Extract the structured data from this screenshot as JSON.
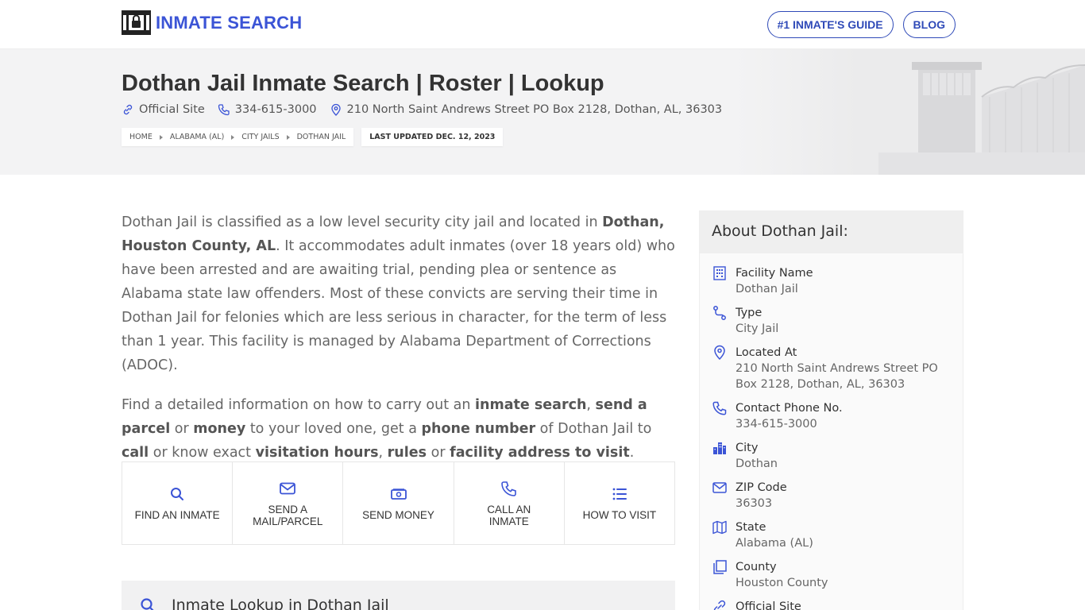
{
  "header": {
    "logo_text": "INMATE SEARCH",
    "nav": [
      "#1 INMATE'S GUIDE",
      "BLOG"
    ]
  },
  "hero": {
    "title": "Dothan Jail Inmate Search | Roster | Lookup",
    "official_site": "Official Site",
    "phone": "334-615-3000",
    "address": "210 North Saint Andrews Street PO Box 2128, Dothan, AL, 36303",
    "breadcrumbs": [
      "HOME",
      "ALABAMA (AL)",
      "CITY JAILS",
      "DOTHAN JAIL"
    ],
    "last_updated": "LAST UPDATED DEC. 12, 2023"
  },
  "intro": {
    "p1": [
      {
        "t": "Dothan Jail is classified as a low level security city jail and located in ",
        "b": false
      },
      {
        "t": "Dothan, Houston County, AL",
        "b": true
      },
      {
        "t": ". It accommodates adult inmates (over 18 years old) who have been arrested and are awaiting trial, pending plea or sentence as Alabama state law offenders. Most of these convicts are serving their time in Dothan Jail for felonies which are less serious in character, for the term of less than 1 year. This facility is managed by Alabama Department of Corrections (ADOC).",
        "b": false
      }
    ],
    "p2": [
      {
        "t": "Find a detailed information on how to carry out an ",
        "b": false
      },
      {
        "t": "inmate search",
        "b": true
      },
      {
        "t": ", ",
        "b": false
      },
      {
        "t": "send a parcel",
        "b": true
      },
      {
        "t": " or ",
        "b": false
      },
      {
        "t": "money",
        "b": true
      },
      {
        "t": " to your loved one, get a ",
        "b": false
      },
      {
        "t": "phone number",
        "b": true
      },
      {
        "t": " of Dothan Jail to ",
        "b": false
      },
      {
        "t": "call",
        "b": true
      },
      {
        "t": " or know exact ",
        "b": false
      },
      {
        "t": "visitation hours",
        "b": true
      },
      {
        "t": ", ",
        "b": false
      },
      {
        "t": "rules",
        "b": true
      },
      {
        "t": " or ",
        "b": false
      },
      {
        "t": "facility address to visit",
        "b": true
      },
      {
        "t": ".",
        "b": false
      }
    ]
  },
  "tiles": [
    {
      "label_1": "FIND AN INMATE",
      "label_2": "",
      "icon": "search-icon"
    },
    {
      "label_1": "SEND A",
      "label_2": "MAIL/PARCEL",
      "icon": "mail-icon"
    },
    {
      "label_1": "SEND MONEY",
      "label_2": "",
      "icon": "money-icon"
    },
    {
      "label_1": "CALL AN",
      "label_2": "INMATE",
      "icon": "phone-icon"
    },
    {
      "label_1": "HOW TO VISIT",
      "label_2": "",
      "icon": "list-icon"
    }
  ],
  "lookup_title": "Inmate Lookup in Dothan Jail",
  "about": {
    "title": "About Dothan Jail:",
    "facts": [
      {
        "label": "Facility Name",
        "value": "Dothan Jail",
        "icon": "building-icon"
      },
      {
        "label": "Type",
        "value": "City Jail",
        "icon": "route-icon"
      },
      {
        "label": "Located At",
        "value": "210 North Saint Andrews Street PO Box 2128, Dothan, AL, 36303",
        "icon": "map-pin-icon"
      },
      {
        "label": "Contact Phone No.",
        "value": "334-615-3000",
        "icon": "phone-icon"
      },
      {
        "label": "City",
        "value": "Dothan",
        "icon": "city-icon"
      },
      {
        "label": "ZIP Code",
        "value": "36303",
        "icon": "mail-icon"
      },
      {
        "label": "State",
        "value": "Alabama (AL)",
        "icon": "map-icon"
      },
      {
        "label": "County",
        "value": "Houston County",
        "icon": "copy-icon"
      },
      {
        "label": "Official Site",
        "value": "",
        "icon": "link-icon"
      }
    ]
  },
  "colors": {
    "accent": "#3b54d6",
    "nav_border": "#2f4ab8"
  }
}
